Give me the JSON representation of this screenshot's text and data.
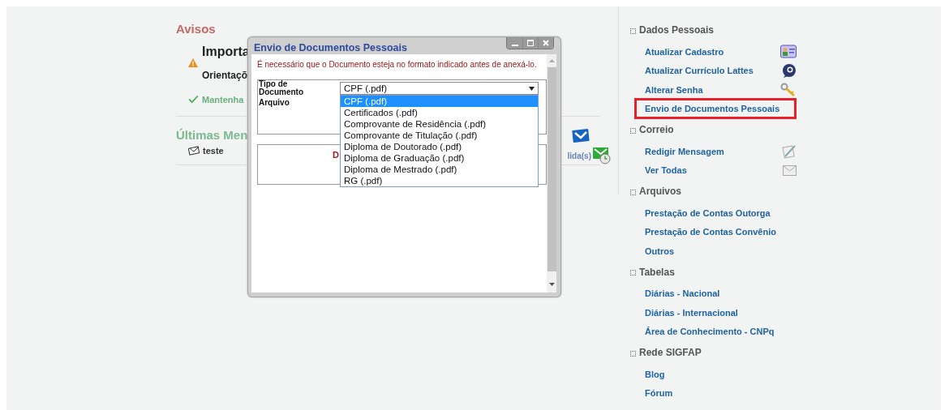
{
  "avisos": {
    "title": "Avisos",
    "notice_title": "Importa",
    "notice_text": "Orientaçõ",
    "status_text": "Mantenha"
  },
  "messages": {
    "title": "Últimas Men",
    "items": [
      {
        "subject": "teste"
      }
    ],
    "read_label": "lida(s)"
  },
  "dialog": {
    "title": "Envio de Documentos Pessoais",
    "notice": "É necessário que o Documento esteja no formato indicado antes de anexá-lo.",
    "fields": [
      {
        "label": "Tipo de Documento"
      },
      {
        "label": "Arquivo"
      }
    ],
    "select": {
      "value": "CPF (.pdf)",
      "expanded": true,
      "options": [
        {
          "label": "CPF (.pdf)",
          "selected": true
        },
        {
          "label": "Certificados (.pdf)",
          "selected": false
        },
        {
          "label": "Comprovante de Residência (.pdf)",
          "selected": false
        },
        {
          "label": "Comprovante de Titulação (.pdf)",
          "selected": false
        },
        {
          "label": "Diploma de Doutorado (.pdf)",
          "selected": false
        },
        {
          "label": "Diploma de Graduação (.pdf)",
          "selected": false
        },
        {
          "label": "Diploma de Mestrado (.pdf)",
          "selected": false
        },
        {
          "label": "RG (.pdf)",
          "selected": false
        }
      ]
    },
    "second_box_text": "D"
  },
  "sidebar": {
    "sections": [
      {
        "title": "Dados Pessoais",
        "items": [
          {
            "label": "Atualizar Cadastro",
            "kind": "card",
            "highlighted": false
          },
          {
            "label": "Atualizar Currículo Lattes",
            "kind": "lattes",
            "highlighted": false
          },
          {
            "label": "Alterar Senha",
            "kind": "key",
            "highlighted": false
          },
          {
            "label": "Envio de Documentos Pessoais",
            "highlighted": true
          }
        ]
      },
      {
        "title": "Correio",
        "items": [
          {
            "label": "Redigir Mensagem",
            "kind": "pen",
            "highlighted": false
          },
          {
            "label": "Ver Todas",
            "kind": "mail",
            "highlighted": false
          }
        ]
      },
      {
        "title": "Arquivos",
        "items": [
          {
            "label": "Prestação de Contas Outorga",
            "highlighted": false
          },
          {
            "label": "Prestação de Contas Convênio",
            "highlighted": false
          },
          {
            "label": "Outros",
            "highlighted": false
          }
        ]
      },
      {
        "title": "Tabelas",
        "items": [
          {
            "label": "Diárias - Nacional",
            "highlighted": false
          },
          {
            "label": "Diárias - Internacional",
            "highlighted": false
          },
          {
            "label": "Área de Conhecimento - CNPq",
            "highlighted": false
          }
        ]
      },
      {
        "title": "Rede SIGFAP",
        "items": [
          {
            "label": "Blog",
            "highlighted": false
          },
          {
            "label": "Fórum",
            "highlighted": false
          }
        ]
      }
    ]
  }
}
